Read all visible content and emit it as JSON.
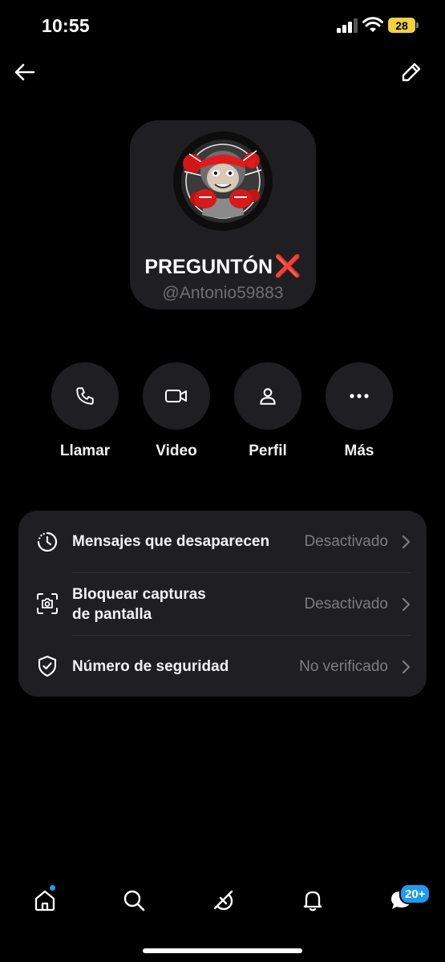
{
  "status": {
    "time": "10:55",
    "battery": "28"
  },
  "header": {
    "back_icon": "arrow-left-icon",
    "edit_icon": "pencil-icon"
  },
  "profile": {
    "name": "PREGUNTÓN",
    "name_emoji": "❌",
    "handle": "@Antonio59883"
  },
  "actions": [
    {
      "label": "Llamar",
      "icon": "phone-icon"
    },
    {
      "label": "Video",
      "icon": "video-camera-icon"
    },
    {
      "label": "Perfil",
      "icon": "person-icon"
    },
    {
      "label": "Más",
      "icon": "more-dots-icon"
    }
  ],
  "settings": [
    {
      "label": "Mensajes que desaparecen",
      "value": "Desactivado",
      "icon": "timer-icon"
    },
    {
      "label_line1": "Bloquear capturas",
      "label_line2": "de pantalla",
      "value": "Desactivado",
      "icon": "screenshot-camera-icon"
    },
    {
      "label": "Número de seguridad",
      "value": "No verificado",
      "icon": "shield-check-icon"
    }
  ],
  "bottom_nav": {
    "items": [
      "home-icon",
      "search-icon",
      "grok-icon",
      "bell-icon",
      "messages-icon"
    ],
    "messages_badge": "20+"
  },
  "colors": {
    "accent": "#1d9bf0",
    "card": "#1f1f22",
    "red_x": "#e21b1b"
  }
}
